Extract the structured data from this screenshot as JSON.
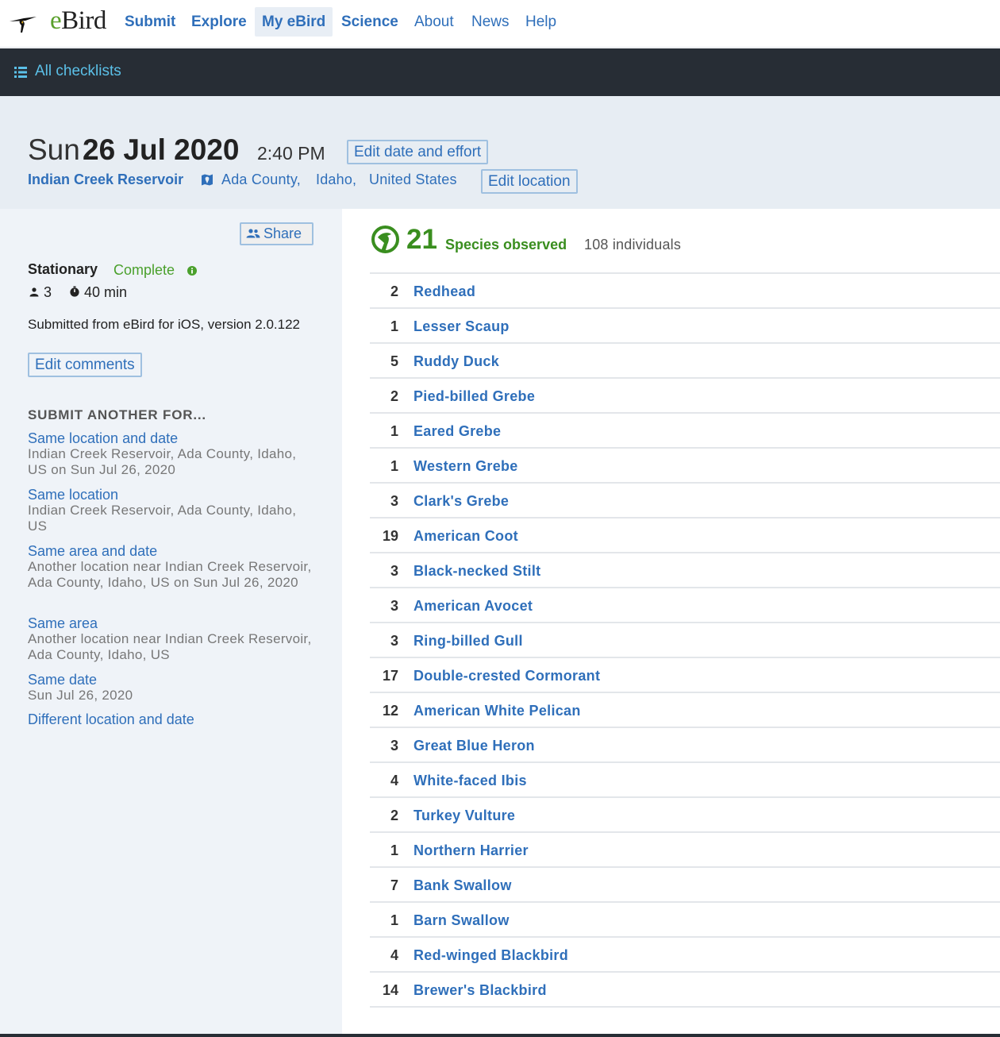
{
  "nav": {
    "logo_e": "e",
    "logo_rest": "Bird",
    "items": [
      {
        "label": "Submit"
      },
      {
        "label": "Explore"
      },
      {
        "label": "My eBird"
      },
      {
        "label": "Science"
      },
      {
        "label": "About"
      },
      {
        "label": "News"
      },
      {
        "label": "Help"
      }
    ]
  },
  "subnav": {
    "label": "All checklists",
    "icon": "list-icon"
  },
  "header": {
    "day": "Sun",
    "date": "26 Jul 2020",
    "time": "2:40 PM",
    "edit_date_label": "Edit date and effort",
    "location_name": "Indian Creek Reservoir",
    "county": "Ada County,",
    "state": "Idaho,",
    "country": "United States",
    "edit_location_label": "Edit location"
  },
  "sidebar": {
    "share_label": "Share",
    "protocol": "Stationary",
    "status": "Complete",
    "party_size": "3",
    "duration": "40 min",
    "submitted_text": "Submitted from eBird for iOS, version 2.0.122",
    "edit_comments_label": "Edit comments",
    "submit_another_heading": "SUBMIT ANOTHER FOR...",
    "links": [
      {
        "label": "Same location and date",
        "desc": "Indian Creek Reservoir, Ada County, Idaho, US on Sun Jul 26, 2020"
      },
      {
        "label": "Same location",
        "desc": "Indian Creek Reservoir, Ada County, Idaho, US"
      },
      {
        "label": "Same area and date",
        "desc": "Another location near Indian Creek Reservoir, Ada County, Idaho, US on Sun Jul 26, 2020"
      },
      {
        "label": "Same area",
        "desc": "Another location near Indian Creek Reservoir, Ada County, Idaho, US"
      },
      {
        "label": "Same date",
        "desc": "Sun Jul 26, 2020"
      },
      {
        "label": "Different location and date",
        "desc": ""
      }
    ]
  },
  "summary": {
    "species_count": "21",
    "species_label": "Species observed",
    "individuals": "108 individuals"
  },
  "observations": [
    {
      "count": "2",
      "name": "Redhead"
    },
    {
      "count": "1",
      "name": "Lesser Scaup"
    },
    {
      "count": "5",
      "name": "Ruddy Duck"
    },
    {
      "count": "2",
      "name": "Pied-billed Grebe"
    },
    {
      "count": "1",
      "name": "Eared Grebe"
    },
    {
      "count": "1",
      "name": "Western Grebe"
    },
    {
      "count": "3",
      "name": "Clark's Grebe"
    },
    {
      "count": "19",
      "name": "American Coot"
    },
    {
      "count": "3",
      "name": "Black-necked Stilt"
    },
    {
      "count": "3",
      "name": "American Avocet"
    },
    {
      "count": "3",
      "name": "Ring-billed Gull"
    },
    {
      "count": "17",
      "name": "Double-crested Cormorant"
    },
    {
      "count": "12",
      "name": "American White Pelican"
    },
    {
      "count": "3",
      "name": "Great Blue Heron"
    },
    {
      "count": "4",
      "name": "White-faced Ibis"
    },
    {
      "count": "2",
      "name": "Turkey Vulture"
    },
    {
      "count": "1",
      "name": "Northern Harrier"
    },
    {
      "count": "7",
      "name": "Bank Swallow"
    },
    {
      "count": "1",
      "name": "Barn Swallow"
    },
    {
      "count": "4",
      "name": "Red-winged Blackbird"
    },
    {
      "count": "14",
      "name": "Brewer's Blackbird"
    }
  ],
  "colors": {
    "link": "#2f6fba",
    "accent_green": "#3a8e1f",
    "dark_bar": "#272d35"
  }
}
